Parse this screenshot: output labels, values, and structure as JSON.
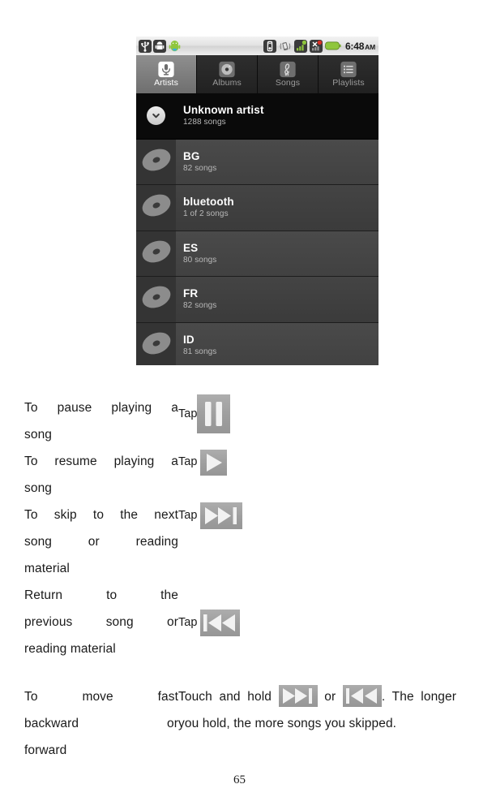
{
  "phone": {
    "status_bar": {
      "icons_left": [
        "usb-icon",
        "android-debug-icon",
        "android-mascot-icon"
      ],
      "icons_right": [
        "alarm-icon",
        "vibrate-icon",
        "signal-bars-icon",
        "signal-bars-x-icon",
        "battery-icon"
      ],
      "time": "6:48",
      "meridiem": "AM"
    },
    "tabs": [
      {
        "label": "Artists",
        "icon": "microphone-icon",
        "selected": true
      },
      {
        "label": "Albums",
        "icon": "disc-icon",
        "selected": false
      },
      {
        "label": "Songs",
        "icon": "treble-clef-icon",
        "selected": false
      },
      {
        "label": "Playlists",
        "icon": "list-icon",
        "selected": false
      }
    ],
    "list": [
      {
        "title": "Unknown artist",
        "subtitle": "1288 songs",
        "header": true,
        "icon": "chevron-down-icon"
      },
      {
        "title": "BG",
        "subtitle": "82 songs",
        "header": false,
        "icon": "disc-icon"
      },
      {
        "title": "bluetooth",
        "subtitle": "1 of 2 songs",
        "header": false,
        "icon": "disc-icon"
      },
      {
        "title": "ES",
        "subtitle": "80 songs",
        "header": false,
        "icon": "disc-icon"
      },
      {
        "title": "FR",
        "subtitle": "82 songs",
        "header": false,
        "icon": "disc-icon"
      },
      {
        "title": "ID",
        "subtitle": "81 songs",
        "header": false,
        "icon": "disc-icon"
      }
    ]
  },
  "manual": {
    "rows": [
      {
        "task_lines": [
          "To pause playing a",
          "song"
        ],
        "action_label": "Tap",
        "action_icon": "pause-icon"
      },
      {
        "task_lines": [
          "To resume playing a",
          "song"
        ],
        "action_label": "Tap",
        "action_icon": "play-icon"
      },
      {
        "task_lines": [
          "To skip to the next",
          "song or reading",
          "material"
        ],
        "action_label": "Tap",
        "action_icon": "next-track-icon"
      },
      {
        "task_lines": [
          "Return to the",
          "previous song or",
          "reading material"
        ],
        "action_label": "Tap",
        "action_icon": "previous-track-icon"
      }
    ],
    "fast_row": {
      "task_lines": [
        "To  move  fast",
        "backward  or",
        "forward"
      ],
      "text_before": "Touch and hold",
      "icon_1": "next-track-icon",
      "text_middle": "or",
      "icon_2": "previous-track-icon",
      "text_after": ". The longer you hold, the more songs you skipped."
    }
  },
  "page_number": "65"
}
